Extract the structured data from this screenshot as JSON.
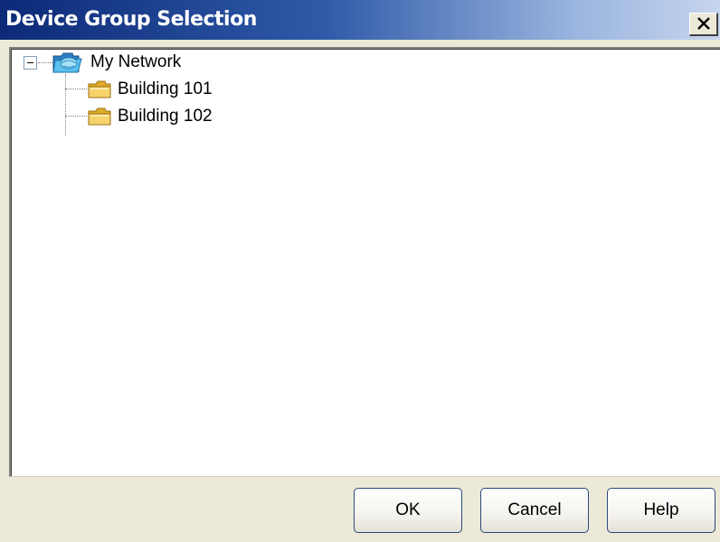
{
  "window": {
    "title": "Device Group Selection",
    "close_glyph": "X"
  },
  "tree": {
    "root": {
      "label": "My Network",
      "icon": "network-folder-icon",
      "expanded": true,
      "children": [
        {
          "label": "Building 101",
          "icon": "folder-icon"
        },
        {
          "label": "Building 102",
          "icon": "folder-icon"
        }
      ]
    }
  },
  "buttons": {
    "ok_label": "OK",
    "cancel_label": "Cancel",
    "help_label": "Help"
  },
  "colors": {
    "titlebar_dark": "#0c2a78",
    "titlebar_light": "#c7d5ee",
    "dialog_bg": "#ece9d8",
    "folder_yellow": "#f6d36b",
    "network_blue": "#3aa7e0"
  }
}
